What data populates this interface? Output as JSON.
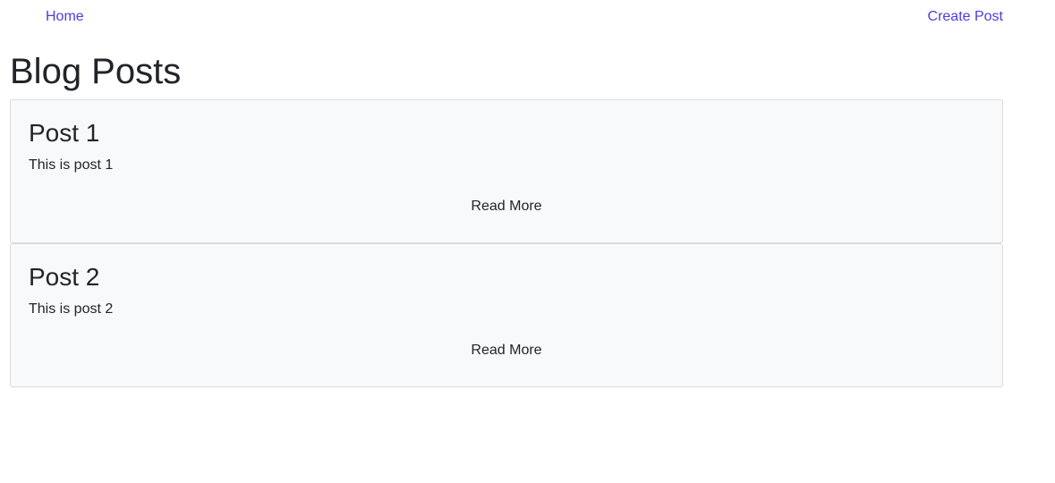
{
  "nav": {
    "home_label": "Home",
    "create_label": "Create Post"
  },
  "page": {
    "title": "Blog Posts"
  },
  "posts": [
    {
      "title": "Post 1",
      "body": "This is post 1",
      "action": "Read More"
    },
    {
      "title": "Post 2",
      "body": "This is post 2",
      "action": "Read More"
    }
  ],
  "colors": {
    "link": "#4a3fe0",
    "card_bg": "#f8f9fa",
    "card_border": "#d9dadb",
    "text": "#212529"
  }
}
